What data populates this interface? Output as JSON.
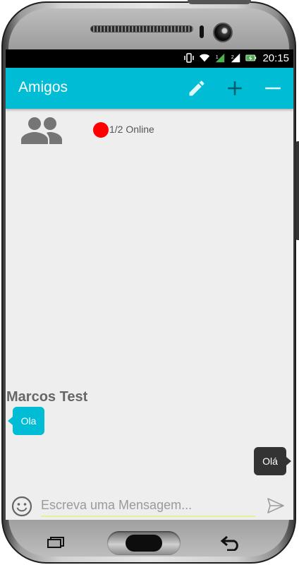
{
  "status_bar": {
    "time": "20:15",
    "icons": [
      "vibrate-icon",
      "wifi-icon",
      "signal-1-icon",
      "signal-2-icon",
      "battery-charging-icon"
    ],
    "signal_1_label": "1",
    "signal_2_label": "2"
  },
  "app_bar": {
    "title": "Amigos",
    "actions": [
      "edit-icon",
      "add-icon",
      "remove-icon"
    ],
    "color": "#00bcd4"
  },
  "group": {
    "icon": "group-icon",
    "status_color": "#ff0000",
    "online_text": "1/2 Online"
  },
  "messages": {
    "incoming": {
      "sender": "Marcos Test",
      "text": "Ola",
      "color": "#00bcd4"
    },
    "outgoing": {
      "text": "Olá",
      "color": "#333333"
    }
  },
  "composer": {
    "placeholder": "Escreva uma Mensagem...",
    "value": "",
    "emoji_icon": "emoji-icon",
    "send_icon": "send-icon"
  },
  "hardware": {
    "keys": [
      "recent-apps-icon",
      "home-button",
      "back-icon"
    ]
  }
}
